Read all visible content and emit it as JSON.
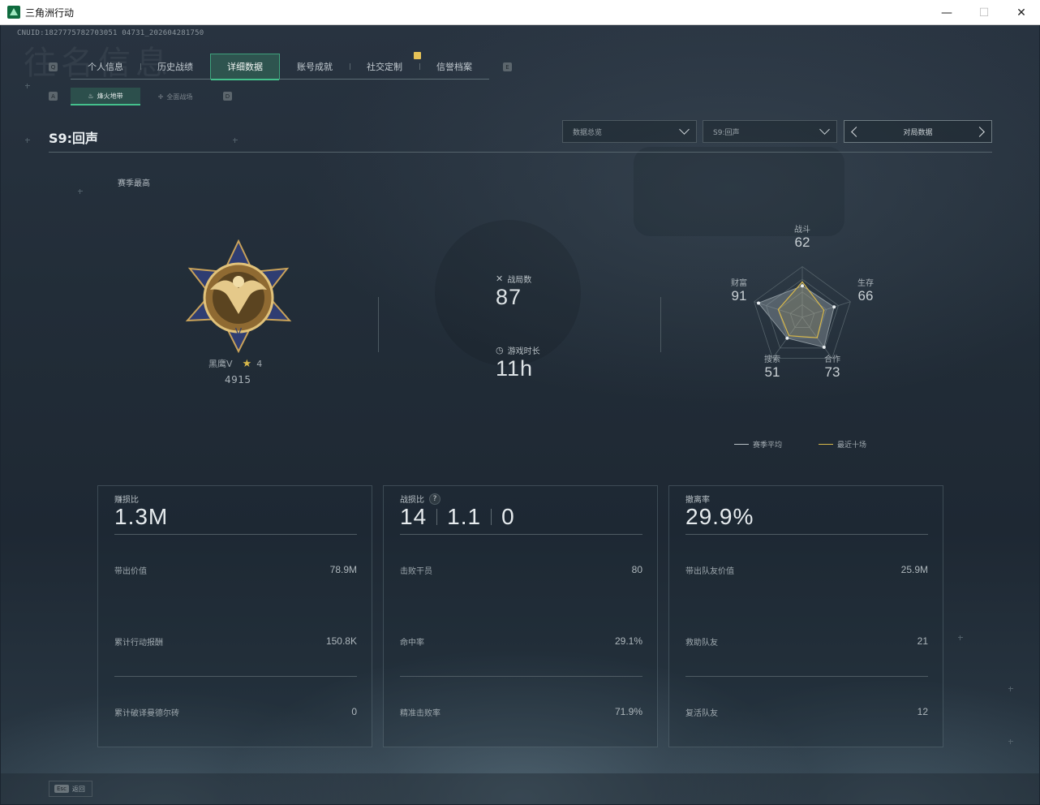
{
  "window": {
    "title": "三角洲行动",
    "min": "—",
    "max": "☐",
    "close": "✕"
  },
  "uid": "CNUID:1827775782703051 04731_202604281750",
  "watermark": "往名信息",
  "tabs": [
    {
      "label": "个人信息",
      "active": false
    },
    {
      "label": "历史战绩",
      "active": false
    },
    {
      "label": "详细数据",
      "active": true
    },
    {
      "label": "账号成就",
      "active": false
    },
    {
      "label": "社交定制",
      "active": false
    },
    {
      "label": "信誉档案",
      "active": false
    }
  ],
  "tab_keys": {
    "left": "Q",
    "right": "E"
  },
  "subtabs": [
    {
      "label": "烽火地带",
      "active": true,
      "icon": "flame-icon"
    },
    {
      "label": "全面战场",
      "active": false,
      "icon": "crosshair-icon"
    }
  ],
  "subtab_keys": {
    "left": "A",
    "right": "D"
  },
  "season": {
    "title": "S9:回声"
  },
  "dropdowns": {
    "overview": "数据总览",
    "season": "S9:回声"
  },
  "pager": {
    "label": "对局数据"
  },
  "season_best": {
    "label": "赛季最高",
    "rank_name": "黑鹰V",
    "stars": "4",
    "score": "4915"
  },
  "matches": {
    "label": "战局数",
    "value": "87"
  },
  "playtime": {
    "label": "游戏时长",
    "value": "11h"
  },
  "radar": {
    "axes": [
      {
        "label": "战斗",
        "value": "62",
        "avg": 62,
        "recent": 70
      },
      {
        "label": "生存",
        "value": "66",
        "avg": 66,
        "recent": 45
      },
      {
        "label": "合作",
        "value": "73",
        "avg": 73,
        "recent": 50
      },
      {
        "label": "搜索",
        "value": "51",
        "avg": 51,
        "recent": 45
      },
      {
        "label": "财富",
        "value": "91",
        "avg": 91,
        "recent": 50
      }
    ],
    "max": 100,
    "colors": {
      "avg": "#8d989f",
      "recent": "#d9b94a"
    }
  },
  "legend": {
    "avg": "赛季平均",
    "recent": "最近十场"
  },
  "cards": {
    "profit": {
      "title": "赚损比",
      "value": "1.3M",
      "rows": [
        {
          "label": "带出价值",
          "value": "78.9M"
        },
        {
          "label": "累计行动报酬",
          "value": "150.8K"
        },
        {
          "label": "累计破译曼德尔砖",
          "value": "0"
        }
      ]
    },
    "kd": {
      "title": "战损比",
      "help": "?",
      "kills": "14",
      "ratio": "1.1",
      "deaths": "0",
      "rows": [
        {
          "label": "击败干员",
          "value": "80"
        },
        {
          "label": "命中率",
          "value": "29.1%"
        },
        {
          "label": "精准击败率",
          "value": "71.9%"
        }
      ]
    },
    "extract": {
      "title": "撤离率",
      "value": "29.9%",
      "rows": [
        {
          "label": "带出队友价值",
          "value": "25.9M"
        },
        {
          "label": "救助队友",
          "value": "21"
        },
        {
          "label": "复活队友",
          "value": "12"
        }
      ]
    }
  },
  "footer": {
    "esc_key": "Esc",
    "esc_label": "返回"
  }
}
